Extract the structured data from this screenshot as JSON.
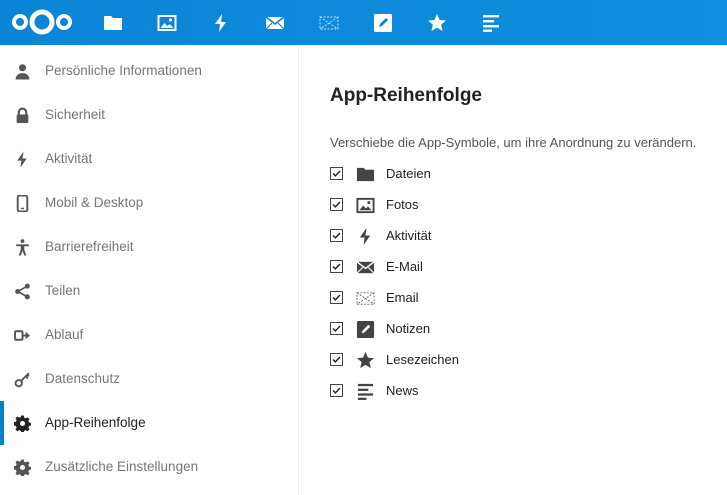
{
  "colors": {
    "header": "#0a84d6",
    "accent": "#0082c9",
    "icon_white": "#ffffff",
    "icon_gray": "#555555",
    "text_muted": "#767676"
  },
  "header": {
    "logo": "nextcloud-logo-icon",
    "apps": [
      {
        "icon": "folder-icon"
      },
      {
        "icon": "image-icon"
      },
      {
        "icon": "lightning-icon"
      },
      {
        "icon": "mail-icon"
      },
      {
        "icon": "mail-crossed-icon"
      },
      {
        "icon": "notes-icon"
      },
      {
        "icon": "star-icon"
      },
      {
        "icon": "news-icon"
      }
    ]
  },
  "sidebar": {
    "items": [
      {
        "label": "Persönliche Informationen",
        "icon": "user-icon"
      },
      {
        "label": "Sicherheit",
        "icon": "lock-icon"
      },
      {
        "label": "Aktivität",
        "icon": "lightning-icon"
      },
      {
        "label": "Mobil & Desktop",
        "icon": "phone-icon"
      },
      {
        "label": "Barrierefreiheit",
        "icon": "accessibility-icon"
      },
      {
        "label": "Teilen",
        "icon": "share-icon"
      },
      {
        "label": "Ablauf",
        "icon": "flow-icon"
      },
      {
        "label": "Datenschutz",
        "icon": "key-icon"
      },
      {
        "label": "App-Reihenfolge",
        "icon": "gear-icon",
        "active": true
      },
      {
        "label": "Zusätzliche Einstellungen",
        "icon": "gear-icon"
      }
    ]
  },
  "main": {
    "title": "App-Reihenfolge",
    "description": "Verschiebe die App-Symbole, um ihre Anordnung zu verändern.",
    "apps": [
      {
        "label": "Dateien",
        "icon": "folder-icon",
        "checked": true
      },
      {
        "label": "Fotos",
        "icon": "image-icon",
        "checked": true
      },
      {
        "label": "Aktivität",
        "icon": "lightning-icon",
        "checked": true
      },
      {
        "label": "E-Mail",
        "icon": "mail-icon",
        "checked": true
      },
      {
        "label": "Email",
        "icon": "mail-crossed-icon",
        "checked": true
      },
      {
        "label": "Notizen",
        "icon": "notes-icon",
        "checked": true
      },
      {
        "label": "Lesezeichen",
        "icon": "star-icon",
        "checked": true
      },
      {
        "label": "News",
        "icon": "news-icon",
        "checked": true
      }
    ]
  }
}
